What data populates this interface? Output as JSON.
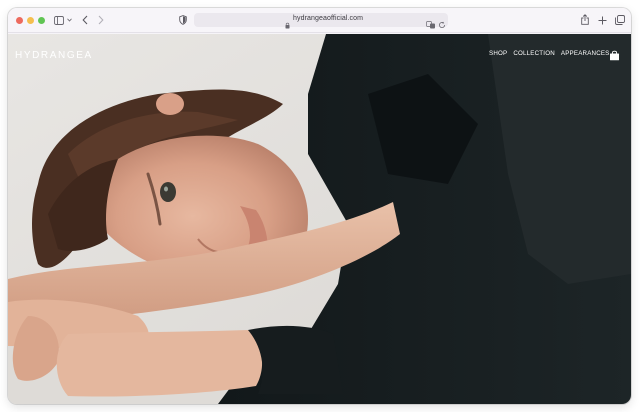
{
  "browser": {
    "url": "hydrangeaofficial.com",
    "lights": [
      "#ed6a5e",
      "#f5bf4f",
      "#61c554"
    ],
    "icons": [
      "sidebar-icon",
      "chevron-down-icon",
      "back-icon",
      "forward-icon",
      "shield-icon",
      "lock-icon",
      "translate-icon",
      "reload-icon",
      "share-icon",
      "new-tab-icon",
      "tabs-icon"
    ]
  },
  "site": {
    "brand": "HYDRANGEA",
    "nav": [
      {
        "label": "SHOP"
      },
      {
        "label": "COLLECTION"
      },
      {
        "label": "APPEARANCES"
      }
    ],
    "bag_icon": "shopping-bag-icon",
    "hero": {
      "subject": "hero-photo"
    }
  }
}
